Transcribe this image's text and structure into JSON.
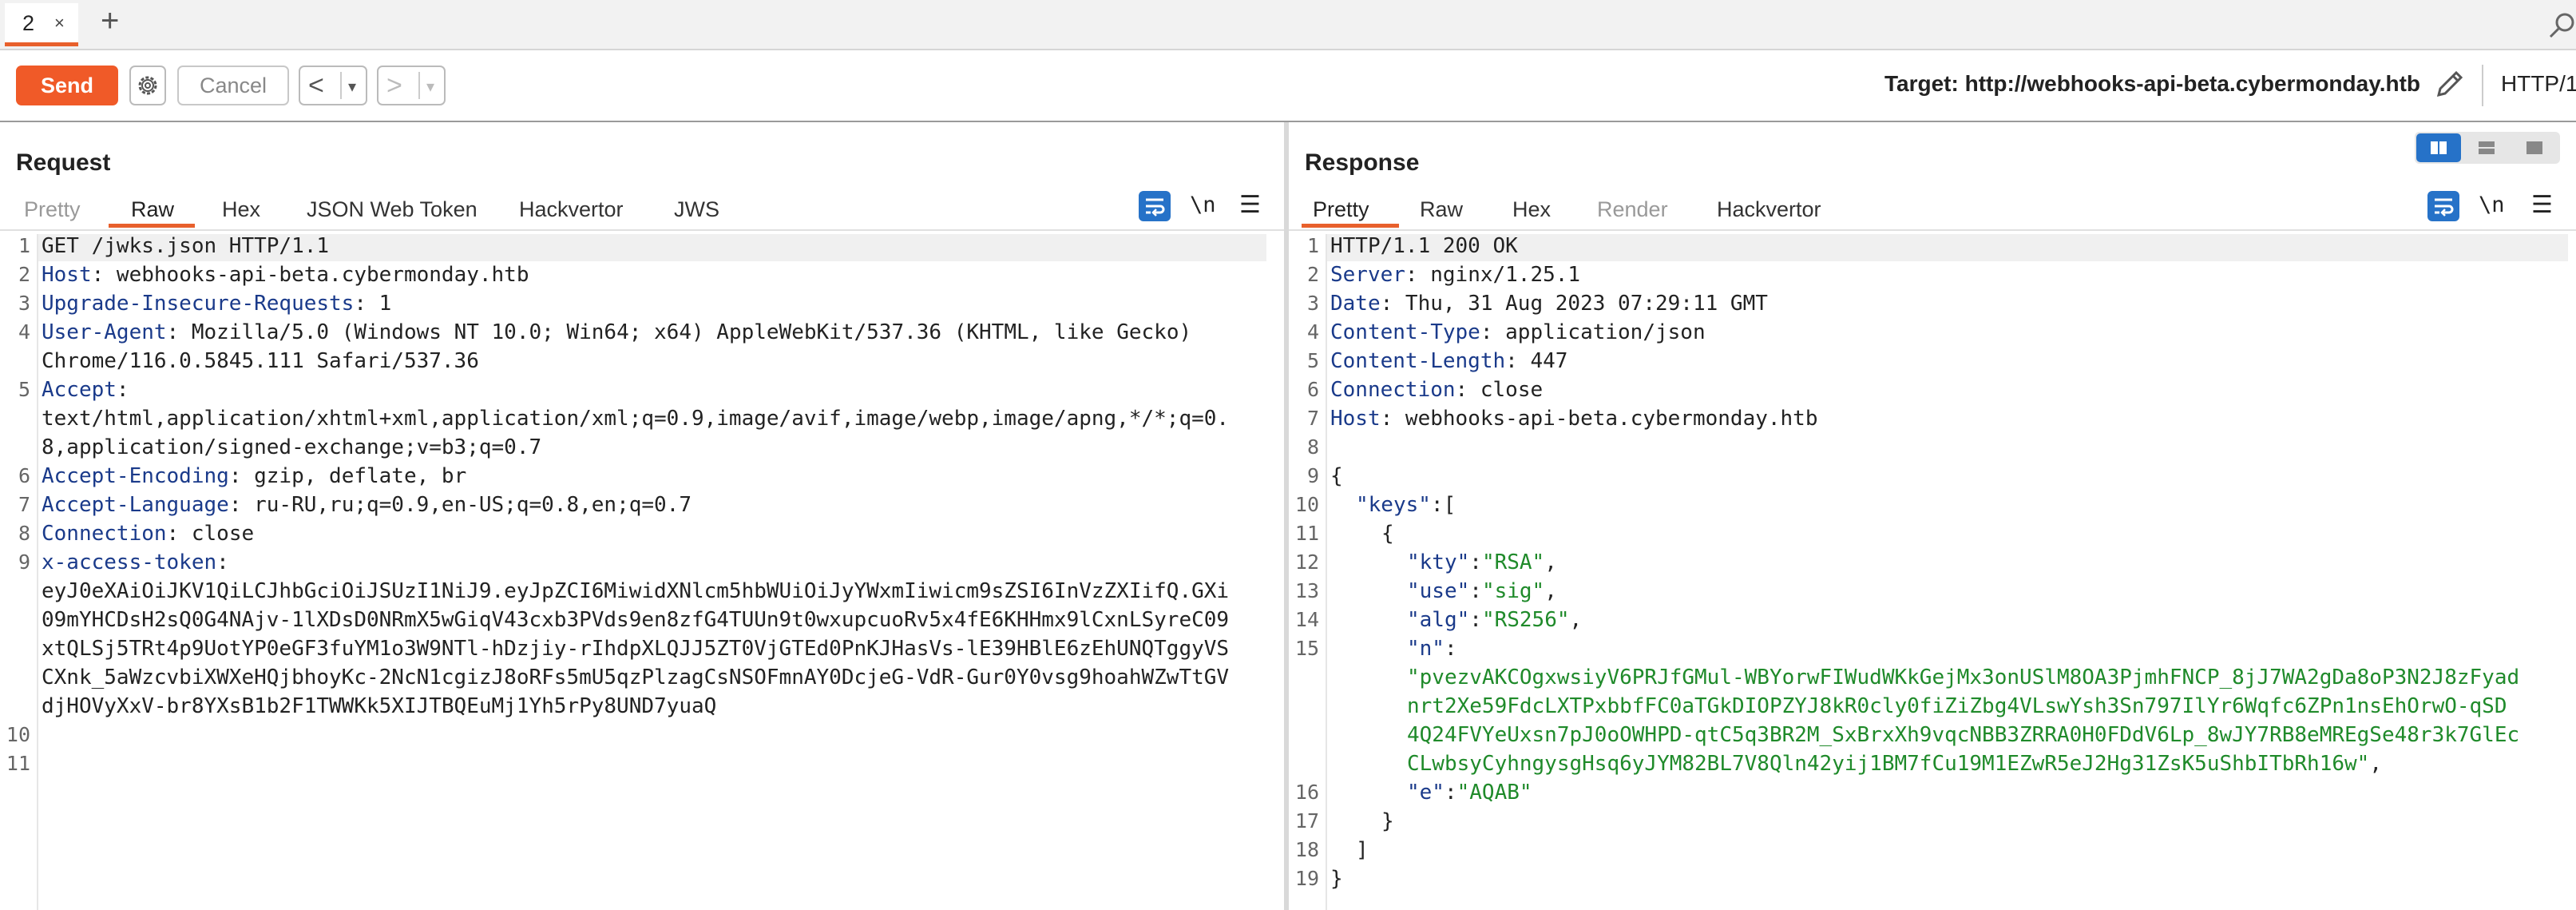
{
  "tab": {
    "label": "2",
    "close": "×",
    "add": "+"
  },
  "toolbar": {
    "send": "Send",
    "cancel": "Cancel",
    "back": "<",
    "forward": ">",
    "caret": "▾",
    "target": "Target: http://webhooks-api-beta.cybermonday.htb",
    "http_version": "HTTP/1"
  },
  "request": {
    "title": "Request",
    "tabs": [
      "Pretty",
      "Raw",
      "Hex",
      "JSON Web Token",
      "Hackvertor",
      "JWS"
    ],
    "active_tab": "Raw",
    "newline_label": "\\n",
    "menu": "☰",
    "line_numbers": [
      "1",
      "2",
      "3",
      "4",
      "5",
      "6",
      "7",
      "8",
      "9",
      "10",
      "11"
    ],
    "lines": [
      {
        "key": "",
        "val": "GET /jwks.json HTTP/1.1"
      },
      {
        "key": "Host",
        "val": ": webhooks-api-beta.cybermonday.htb"
      },
      {
        "key": "Upgrade-Insecure-Requests",
        "val": ": 1"
      },
      {
        "key": "User-Agent",
        "val": ": Mozilla/5.0 (Windows NT 10.0; Win64; x64) AppleWebKit/537.36 (KHTML, like Gecko)"
      },
      {
        "key": "",
        "val": "Chrome/116.0.5845.111 Safari/537.36"
      },
      {
        "key": "Accept",
        "val": ":"
      },
      {
        "key": "",
        "val": "text/html,application/xhtml+xml,application/xml;q=0.9,image/avif,image/webp,image/apng,*/*;q=0."
      },
      {
        "key": "",
        "val": "8,application/signed-exchange;v=b3;q=0.7"
      },
      {
        "key": "Accept-Encoding",
        "val": ": gzip, deflate, br"
      },
      {
        "key": "Accept-Language",
        "val": ": ru-RU,ru;q=0.9,en-US;q=0.8,en;q=0.7"
      },
      {
        "key": "Connection",
        "val": ": close"
      },
      {
        "key": "x-access-token",
        "val": ":"
      },
      {
        "key": "",
        "val": "eyJ0eXAiOiJKV1QiLCJhbGciOiJSUzI1NiJ9.eyJpZCI6MiwidXNlcm5hbWUiOiJyYWxmIiwicm9sZSI6InVzZXIifQ.GXi"
      },
      {
        "key": "",
        "val": "09mYHCDsH2sQ0G4NAjv-1lXDsD0NRmX5wGiqV43cxb3PVds9en8zfG4TUUn9t0wxupcuoRv5x4fE6KHHmx9lCxnLSyreC09"
      },
      {
        "key": "",
        "val": "xtQLSj5TRt4p9UotYP0eGF3fuYM1o3W9NTl-hDzjiy-rIhdpXLQJJ5ZT0VjGTEd0PnKJHasVs-lE39HBlE6zEhUNQTggyVS"
      },
      {
        "key": "",
        "val": "CXnk_5aWzcvbiXWXeHQjbhoyKc-2NcN1cgizJ8oRFs5mU5qzPlzagCsNSOFmnAY0DcjeG-VdR-Gur0Y0vsg9hoahWZwTtGV"
      },
      {
        "key": "",
        "val": "djHOVyXxV-br8YXsB1b2F1TWWKk5XIJTBQEuMj1Yh5rPy8UND7yuaQ"
      }
    ]
  },
  "response": {
    "title": "Response",
    "tabs": [
      "Pretty",
      "Raw",
      "Hex",
      "Render",
      "Hackvertor"
    ],
    "active_tab": "Pretty",
    "newline_label": "\\n",
    "menu": "☰",
    "line_numbers": [
      "1",
      "2",
      "3",
      "4",
      "5",
      "6",
      "7",
      "8",
      "9",
      "10",
      "11",
      "12",
      "13",
      "14",
      "15",
      "16",
      "17",
      "18",
      "19"
    ],
    "headers": [
      {
        "key": "",
        "val": "HTTP/1.1 200 OK"
      },
      {
        "key": "Server",
        "val": ": nginx/1.25.1"
      },
      {
        "key": "Date",
        "val": ": Thu, 31 Aug 2023 07:29:11 GMT"
      },
      {
        "key": "Content-Type",
        "val": ": application/json"
      },
      {
        "key": "Content-Length",
        "val": ": 447"
      },
      {
        "key": "Connection",
        "val": ": close"
      },
      {
        "key": "Host",
        "val": ": webhooks-api-beta.cybermonday.htb"
      }
    ],
    "json": {
      "open_brace": "{",
      "keys_line_key": "\"keys\"",
      "keys_line_rest": ":[",
      "obj_open": "{",
      "kty_key": "\"kty\"",
      "kty_val": "\"RSA\"",
      "use_key": "\"use\"",
      "use_val": "\"sig\"",
      "alg_key": "\"alg\"",
      "alg_val": "\"RS256\"",
      "n_key": "\"n\"",
      "n_val_lines": [
        "\"pvezvAKCOgxwsiyV6PRJfGMul-WBYorwFIWudWKkGejMx3onUSlM8OA3PjmhFNCP_8jJ7WA2gDa8oP3N2J8zFyad",
        "nrt2Xe59FdcLXTPxbbfFC0aTGkDIOPZYJ8kR0cly0fiZiZbg4VLswYsh3Sn797IlYr6Wqfc6ZPn1nsEhOrwO-qSD",
        "4Q24FVYeUxsn7pJ0oOWHPD-qtC5q3BR2M_SxBrxXh9vqcNBB3ZRRA0H0FDdV6Lp_8wJY7RB8eMREgSe48r3k7GlEc",
        "CLwbsyCyhngysgHsq6yJYM82BL7V8Qln42yij1BM7fCu19M1EZwR5eJ2Hg31ZsK5uShbITbRh16w\""
      ],
      "n_trailing": ",",
      "e_key": "\"e\"",
      "e_val": "\"AQAB\"",
      "obj_close": "}",
      "arr_close": "]",
      "close_brace": "}"
    }
  }
}
